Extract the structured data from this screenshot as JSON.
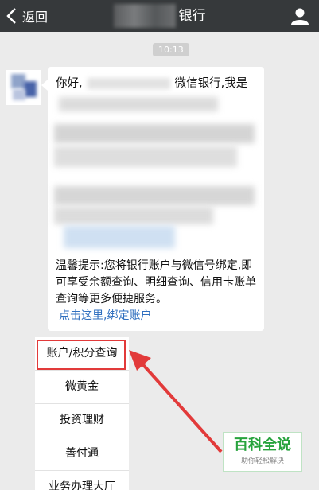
{
  "header": {
    "back_label": "返回",
    "title_suffix": "银行"
  },
  "chat": {
    "timestamp": "10:13",
    "greeting_start": "你好,",
    "greeting_end": "微信银行,我是",
    "tip_text": "温馨提示:您将银行账户与微信号绑定,即可享受余额查询、明细查询、信用卡账单查询等更多便捷服务。",
    "link_text": "点击这里,绑定账户"
  },
  "menu": {
    "items": [
      "账户/积分查询",
      "微黄金",
      "投资理财",
      "善付通",
      "业务办理大厅"
    ]
  },
  "watermark": {
    "main": "百科全说",
    "sub": "助你轻松解决"
  },
  "colors": {
    "topbar": "#36393b",
    "highlight": "#e23a3a",
    "link": "#2f6fbf",
    "watermark_green": "#27a33d"
  }
}
